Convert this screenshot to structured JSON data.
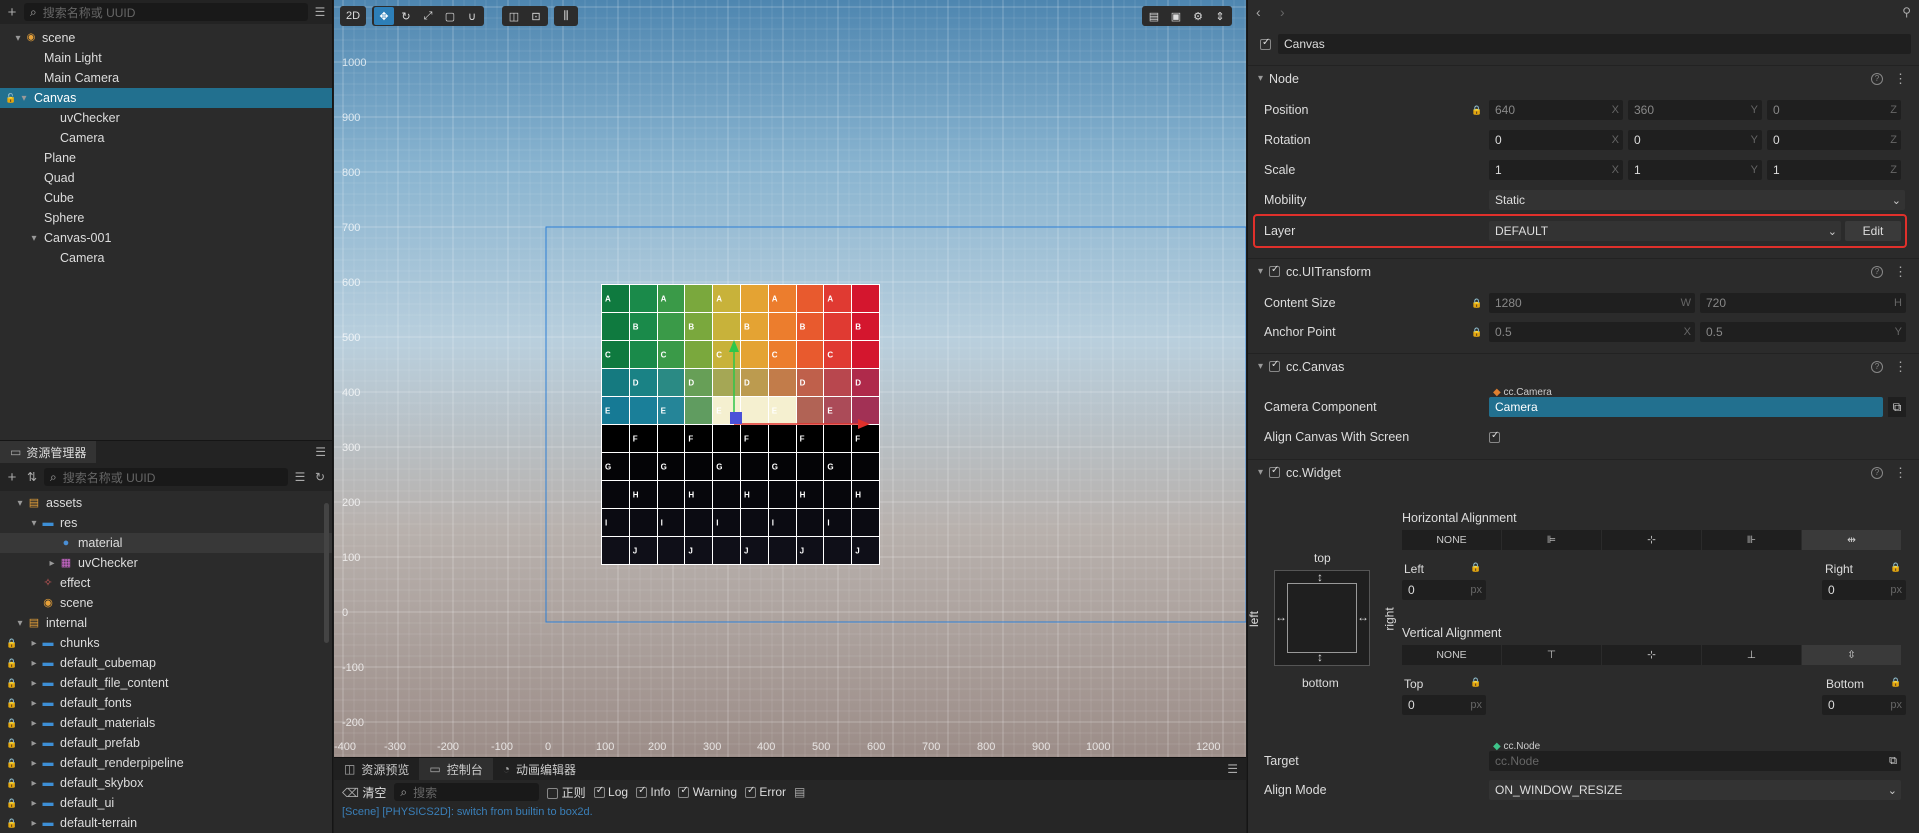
{
  "hierarchy": {
    "search_placeholder": "搜索名称或 UUID",
    "items": [
      {
        "label": "scene",
        "depth": 0,
        "arrow": "▾",
        "selected": false
      },
      {
        "label": "Main Light",
        "depth": 1,
        "arrow": "",
        "selected": false
      },
      {
        "label": "Main Camera",
        "depth": 1,
        "arrow": "",
        "selected": false
      },
      {
        "label": "Canvas",
        "depth": 0,
        "arrow": "▾",
        "selected": true
      },
      {
        "label": "uvChecker",
        "depth": 2,
        "arrow": "",
        "selected": false
      },
      {
        "label": "Camera",
        "depth": 2,
        "arrow": "",
        "selected": false
      },
      {
        "label": "Plane",
        "depth": 1,
        "arrow": "",
        "selected": false
      },
      {
        "label": "Quad",
        "depth": 1,
        "arrow": "",
        "selected": false
      },
      {
        "label": "Cube",
        "depth": 1,
        "arrow": "",
        "selected": false
      },
      {
        "label": "Sphere",
        "depth": 1,
        "arrow": "",
        "selected": false
      },
      {
        "label": "Canvas-001",
        "depth": 1,
        "arrow": "▾",
        "selected": false
      },
      {
        "label": "Camera",
        "depth": 2,
        "arrow": "",
        "selected": false
      }
    ]
  },
  "assets": {
    "tab_label": "资源管理器",
    "search_placeholder": "搜索名称或 UUID",
    "items": [
      {
        "label": "assets",
        "depth": 0,
        "arrow": "▾",
        "kind": "db",
        "locked": false
      },
      {
        "label": "res",
        "depth": 1,
        "arrow": "▾",
        "kind": "folder",
        "locked": false
      },
      {
        "label": "material",
        "depth": 2,
        "arrow": "",
        "kind": "material",
        "locked": false,
        "highlight": true
      },
      {
        "label": "uvChecker",
        "depth": 2,
        "arrow": "▸",
        "kind": "texture",
        "locked": false
      },
      {
        "label": "effect",
        "depth": 1,
        "arrow": "",
        "kind": "effect",
        "locked": false
      },
      {
        "label": "scene",
        "depth": 1,
        "arrow": "",
        "kind": "scene",
        "locked": false
      },
      {
        "label": "internal",
        "depth": 0,
        "arrow": "▾",
        "kind": "db",
        "locked": false
      },
      {
        "label": "chunks",
        "depth": 1,
        "arrow": "▸",
        "kind": "folder",
        "locked": true
      },
      {
        "label": "default_cubemap",
        "depth": 1,
        "arrow": "▸",
        "kind": "folder",
        "locked": true
      },
      {
        "label": "default_file_content",
        "depth": 1,
        "arrow": "▸",
        "kind": "folder",
        "locked": true
      },
      {
        "label": "default_fonts",
        "depth": 1,
        "arrow": "▸",
        "kind": "folder",
        "locked": true
      },
      {
        "label": "default_materials",
        "depth": 1,
        "arrow": "▸",
        "kind": "folder",
        "locked": true
      },
      {
        "label": "default_prefab",
        "depth": 1,
        "arrow": "▸",
        "kind": "folder",
        "locked": true
      },
      {
        "label": "default_renderpipeline",
        "depth": 1,
        "arrow": "▸",
        "kind": "folder",
        "locked": true
      },
      {
        "label": "default_skybox",
        "depth": 1,
        "arrow": "▸",
        "kind": "folder",
        "locked": true
      },
      {
        "label": "default_ui",
        "depth": 1,
        "arrow": "▸",
        "kind": "folder",
        "locked": true
      },
      {
        "label": "default-terrain",
        "depth": 1,
        "arrow": "▸",
        "kind": "folder",
        "locked": true
      }
    ]
  },
  "scene": {
    "mode_2d": "2D",
    "y_ticks": [
      "1000",
      "900",
      "800",
      "700",
      "600",
      "500",
      "400",
      "300",
      "200",
      "100",
      "0",
      "-100",
      "-200"
    ],
    "x_ticks": [
      "-400",
      "-300",
      "-200",
      "-100",
      "0",
      "100",
      "200",
      "300",
      "400",
      "500",
      "600",
      "700",
      "800",
      "900",
      "1000",
      "1200"
    ],
    "grid_rows": [
      "A",
      "B",
      "C",
      "D",
      "E",
      "F",
      "G",
      "H",
      "I",
      "J"
    ],
    "grid_colors": [
      "#0f7a3f",
      "#1a8a4a",
      "#3a9a48",
      "#7aa83d",
      "#c8b23a",
      "#e4a333",
      "#ec7d2d",
      "#e85a2e",
      "#e03a32",
      "#d4162e"
    ]
  },
  "console": {
    "tabs": [
      "资源预览",
      "控制台",
      "动画编辑器"
    ],
    "active_tab": "控制台",
    "clear_label": "清空",
    "search_placeholder": "搜索",
    "regex_label": "正则",
    "filters": [
      "Log",
      "Info",
      "Warning",
      "Error"
    ],
    "log_line": "[Scene] [PHYSICS2D]: switch from builtin to box2d."
  },
  "inspector": {
    "node_name": "Canvas",
    "node_section": "Node",
    "position": {
      "label": "Position",
      "x": "640",
      "y": "360",
      "z": "0"
    },
    "rotation": {
      "label": "Rotation",
      "x": "0",
      "y": "0",
      "z": "0"
    },
    "scale": {
      "label": "Scale",
      "x": "1",
      "y": "1",
      "z": "1"
    },
    "mobility": {
      "label": "Mobility",
      "value": "Static"
    },
    "layer": {
      "label": "Layer",
      "value": "DEFAULT",
      "edit": "Edit",
      "highlight_color": "#e0302b"
    },
    "uitransform": {
      "title": "cc.UITransform",
      "content_size": {
        "label": "Content Size",
        "w": "1280",
        "h": "720"
      },
      "anchor_point": {
        "label": "Anchor Point",
        "x": "0.5",
        "y": "0.5"
      }
    },
    "canvas": {
      "title": "cc.Canvas",
      "camera_component": {
        "label": "Camera Component",
        "type_tag": "cc.Camera",
        "value": "Camera"
      },
      "align_with_screen": {
        "label": "Align Canvas With Screen",
        "checked": true
      }
    },
    "widget": {
      "title": "cc.Widget",
      "horizontal_alignment": "Horizontal Alignment",
      "vertical_alignment": "Vertical Alignment",
      "none": "NONE",
      "top": "top",
      "bottom": "bottom",
      "left": "left",
      "right": "right",
      "left_label": "Left",
      "right_label": "Right",
      "top_label": "Top",
      "bottom_label": "Bottom",
      "left_value": "0",
      "right_value": "0",
      "top_value": "0",
      "bottom_value": "0",
      "unit": "px",
      "target": {
        "label": "Target",
        "type_tag": "cc.Node",
        "placeholder": "cc.Node"
      },
      "align_mode": {
        "label": "Align Mode",
        "value": "ON_WINDOW_RESIZE"
      }
    }
  }
}
